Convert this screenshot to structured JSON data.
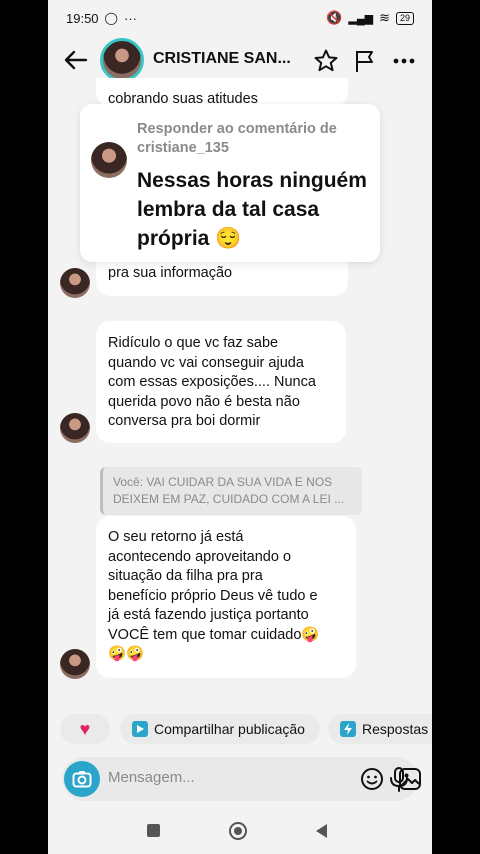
{
  "status": {
    "time": "19:50",
    "battery": "29"
  },
  "header": {
    "title": "CRISTIANE SAN..."
  },
  "messages": {
    "partial_top": "cobrando suas atitudes",
    "msg1_tail": "pra sua informação",
    "msg2": [
      "Ridículo o que vc faz sabe",
      "quando vc vai conseguir ajuda",
      "com essas exposições.... Nunca",
      "querida povo não é besta não",
      "conversa pra boi dormir"
    ],
    "quote": "Você: VAI CUIDAR DA SUA VIDA E NOS DEIXEM EM PAZ, CUIDADO COM A LEI ...",
    "msg3": [
      "O seu retorno já está",
      "acontecendo aproveitando o",
      "situação da filha pra pra",
      "benefício próprio Deus vê tudo e",
      "já está fazendo justiça portanto",
      "VOCÊ tem que tomar cuidado🤪",
      "🤪🤪"
    ]
  },
  "reply_card": {
    "label": "Responder ao comentário de cristiane_135",
    "comment": "Nessas horas ninguém lembra da tal casa própria 😌"
  },
  "chips": {
    "share": "Compartilhar publicação",
    "replies": "Respostas"
  },
  "composer": {
    "placeholder": "Mensagem..."
  },
  "colors": {
    "accent": "#2aa5c9",
    "avatar_ring": "#35c7c7",
    "heart": "#e0245e"
  }
}
